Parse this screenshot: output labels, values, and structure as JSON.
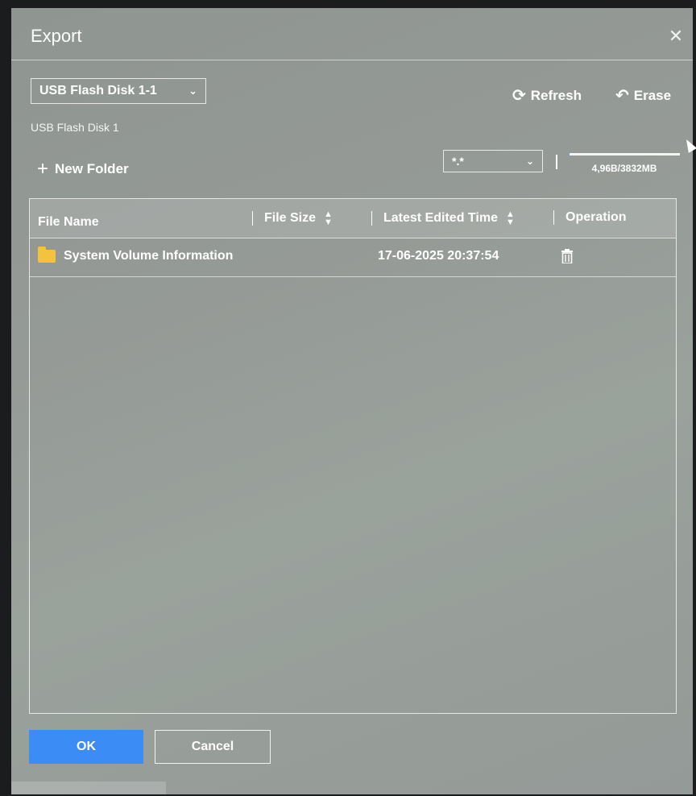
{
  "dialog": {
    "title": "Export",
    "close_icon": "close-icon"
  },
  "disk_selector": {
    "selected": "USB Flash Disk 1-1",
    "caption": "USB Flash Disk 1"
  },
  "actions": {
    "refresh_label": "Refresh",
    "erase_label": "Erase",
    "new_folder_label": "New Folder"
  },
  "filter": {
    "selected": "*.*"
  },
  "capacity": {
    "text": "4,96B/3832MB",
    "used_fraction": 0.0013
  },
  "table": {
    "headers": {
      "name": "File Name",
      "size": "File Size",
      "time": "Latest Edited Time",
      "operation": "Operation"
    },
    "rows": [
      {
        "name": "System Volume Information",
        "size": "",
        "time": "17-06-2025 20:37:54",
        "type_icon": "folder-icon",
        "operation_icon": "trash-icon"
      }
    ]
  },
  "footer": {
    "ok_label": "OK",
    "cancel_label": "Cancel"
  },
  "colors": {
    "accent": "#3b8df5",
    "folder": "#f5c33b"
  }
}
